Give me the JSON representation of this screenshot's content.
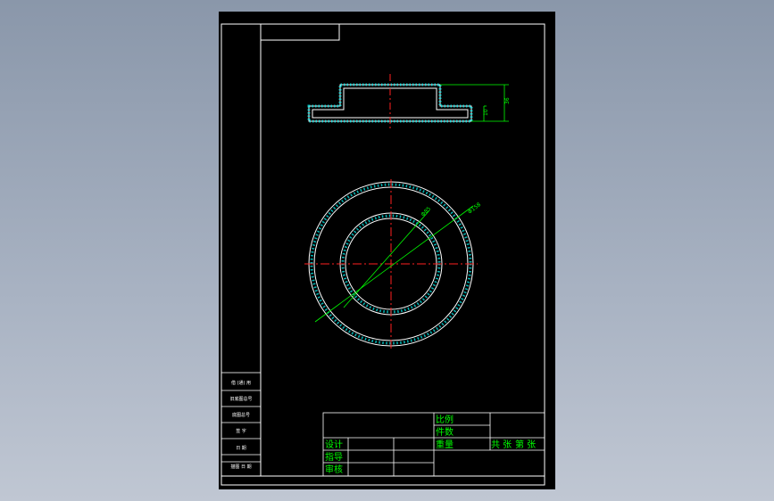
{
  "drawing": {
    "background": "#000000",
    "line_color": "#ffffff",
    "dim_color": "#00ff00",
    "center_color": "#ff2020",
    "hatch_color": "#00ffff",
    "text_color": "#00ff00"
  },
  "section_view": {
    "dim_total_height": "36",
    "dim_step_height": "10"
  },
  "plan_view": {
    "dim_inner_diameter": "Φ85",
    "dim_outer_diameter": "Φ158"
  },
  "title_block": {
    "scale_label": "比例",
    "quantity_label": "件数",
    "weight_label": "重量",
    "design_label": "设计",
    "guide_label": "指导",
    "review_label": "审核",
    "sheets_total": "共  张",
    "sheet_number": "第  张"
  },
  "side_strip": {
    "row1": "借 (通) 用",
    "row2": "旧底图总号",
    "row3": "底图总号",
    "row4": "签   字",
    "row5": "日   期",
    "row6": "描图 日 期"
  }
}
